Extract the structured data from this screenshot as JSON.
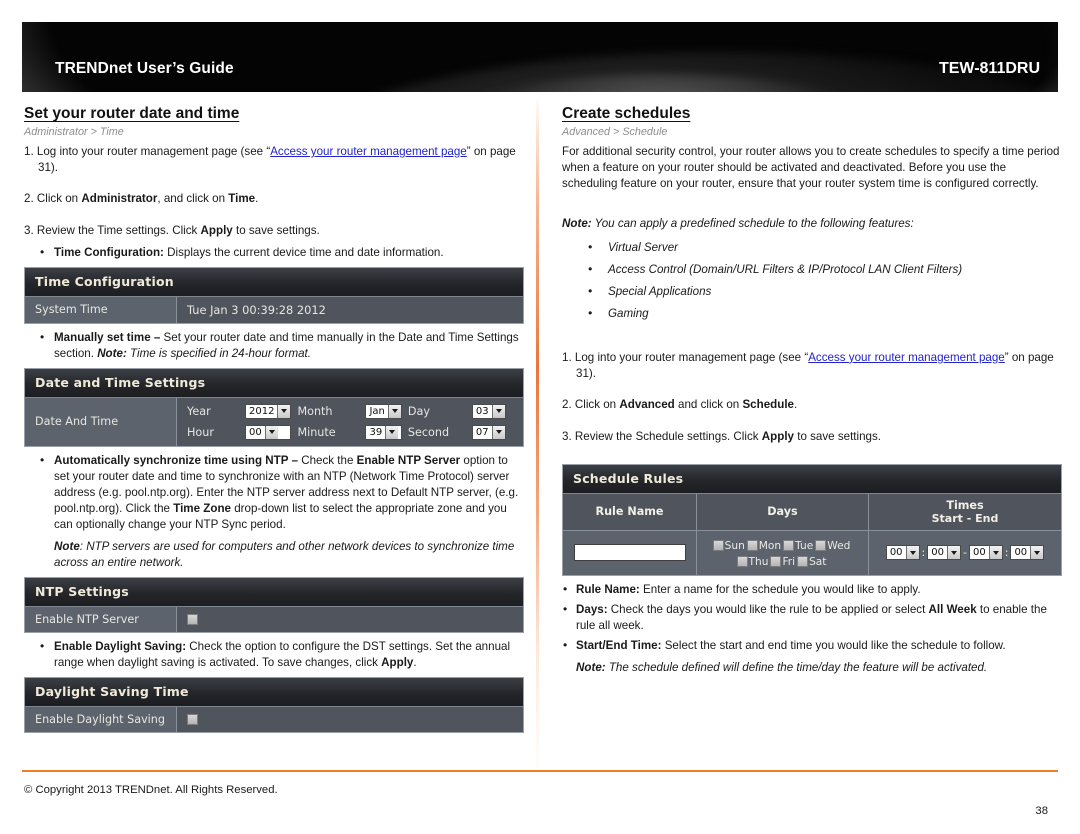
{
  "header": {
    "guide_title": "TRENDnet User’s Guide",
    "model": "TEW-811DRU"
  },
  "left_column": {
    "title": "Set your router date and time",
    "breadcrumb": "Administrator > Time",
    "step1_prefix": "1. Log into your router management page (see “",
    "step1_link": "Access your router management page",
    "step1_suffix": "” on page 31).",
    "step2": "2. Click on ",
    "step2_b1": "Administrator",
    "step2_mid": ", and click on ",
    "step2_b2": "Time",
    "step2_end": ".",
    "step3": "3. Review the Time settings. Click ",
    "step3_b": "Apply",
    "step3_end": " to save settings.",
    "bullet_time_config_b": "Time Configuration:",
    "bullet_time_config": " Displays the current device time and date information.",
    "time_config_panel": {
      "title": "Time Configuration",
      "label": "System Time",
      "value": "Tue Jan 3 00:39:28 2012"
    },
    "bullet_manual_b": "Manually set time –",
    "bullet_manual": " Set your router date and time manually in the Date and Time Settings section. ",
    "bullet_manual_note_b": "Note:",
    "bullet_manual_note": " Time is specified in 24-hour format.",
    "datetime_panel": {
      "title": "Date and Time Settings",
      "row_label": "Date And Time",
      "fields": [
        {
          "label": "Year",
          "value": "2012"
        },
        {
          "label": "Month",
          "value": "Jan"
        },
        {
          "label": "Day",
          "value": "03"
        },
        {
          "label": "Hour",
          "value": "00"
        },
        {
          "label": "Minute",
          "value": "39"
        },
        {
          "label": "Second",
          "value": "07"
        }
      ]
    },
    "bullet_ntp_b1": "Automatically synchronize time using NTP –",
    "bullet_ntp_p1": " Check the ",
    "bullet_ntp_b2": "Enable NTP Server",
    "bullet_ntp_p2": " option to set your router date and time to synchronize with an NTP (Network Time Protocol) server address (e.g. pool.ntp.org). Enter the NTP server address next to Default NTP server, (e.g. pool.ntp.org). Click the ",
    "bullet_ntp_b3": "Time Zone",
    "bullet_ntp_p3": " drop-down list to select the appropriate zone and you can optionally change your NTP Sync period.",
    "ntp_note_b": "Note",
    "ntp_note": ":  NTP servers are used for computers and other network devices to synchronize time across an entire network.",
    "ntp_panel": {
      "title": "NTP Settings",
      "label": "Enable NTP Server",
      "checkbox": "unchecked"
    },
    "bullet_dst_b": "Enable Daylight Saving:",
    "bullet_dst_p1": " Check the option to configure the DST settings. Set the annual range when daylight saving is activated. To save changes, click ",
    "bullet_dst_b2": "Apply",
    "bullet_dst_p2": ".",
    "dst_panel": {
      "title": "Daylight Saving Time",
      "label": "Enable Daylight Saving",
      "checkbox": "unchecked"
    }
  },
  "right_column": {
    "title": "Create schedules",
    "breadcrumb": "Advanced > Schedule",
    "intro": "For additional security control, your router allows you to create schedules to specify a time period when a feature on your router should be activated and deactivated. Before you use the scheduling feature on your router, ensure that your router system time is configured correctly.",
    "note_b": "Note:",
    "note_text": " You can apply a predefined schedule to the following features:",
    "features": [
      "Virtual Server",
      "Access Control (Domain/URL Filters & IP/Protocol LAN Client Filters)",
      "Special Applications",
      "Gaming"
    ],
    "step1_prefix": "1. Log into your router management page (see “",
    "step1_link": "Access your router management page",
    "step1_suffix": "” on page 31).",
    "step2": "2. Click on ",
    "step2_b1": "Advanced",
    "step2_mid": " and click on ",
    "step2_b2": "Schedule",
    "step2_end": ".",
    "step3": "3. Review the Schedule settings. Click ",
    "step3_b": "Apply",
    "step3_end": " to save settings.",
    "schedule_panel": {
      "title": "Schedule Rules",
      "col_rule_name": "Rule Name",
      "col_days": "Days",
      "col_times": "Times",
      "col_times_sub": "Start - End",
      "rule_name_value": "",
      "days": [
        {
          "label": "Sun",
          "checked": false
        },
        {
          "label": "Mon",
          "checked": false
        },
        {
          "label": "Tue",
          "checked": false
        },
        {
          "label": "Wed",
          "checked": false
        },
        {
          "label": "Thu",
          "checked": false
        },
        {
          "label": "Fri",
          "checked": false
        },
        {
          "label": "Sat",
          "checked": false
        }
      ],
      "times": {
        "start_hour": "00",
        "start_minute": "00",
        "separator": "-",
        "end_hour": "00",
        "end_minute": "00"
      }
    },
    "bullet_rule_b": "Rule Name:",
    "bullet_rule": " Enter a name for the schedule you would like to apply.",
    "bullet_days_b": "Days:",
    "bullet_days_p1": " Check the days you would like the rule to be applied or select ",
    "bullet_days_b2": "All Week",
    "bullet_days_p2": " to enable the rule all week.",
    "bullet_time_b": "Start/End Time:",
    "bullet_time": " Select the start and end time you would like the schedule to follow.",
    "bullet_note_b": "Note:",
    "bullet_note": " The schedule defined will define the time/day the feature will be activated."
  },
  "footer": {
    "copyright": "© Copyright 2013 TRENDnet. All Rights Reserved.",
    "page_number": "38",
    "accent_color": "#ef7e28"
  }
}
